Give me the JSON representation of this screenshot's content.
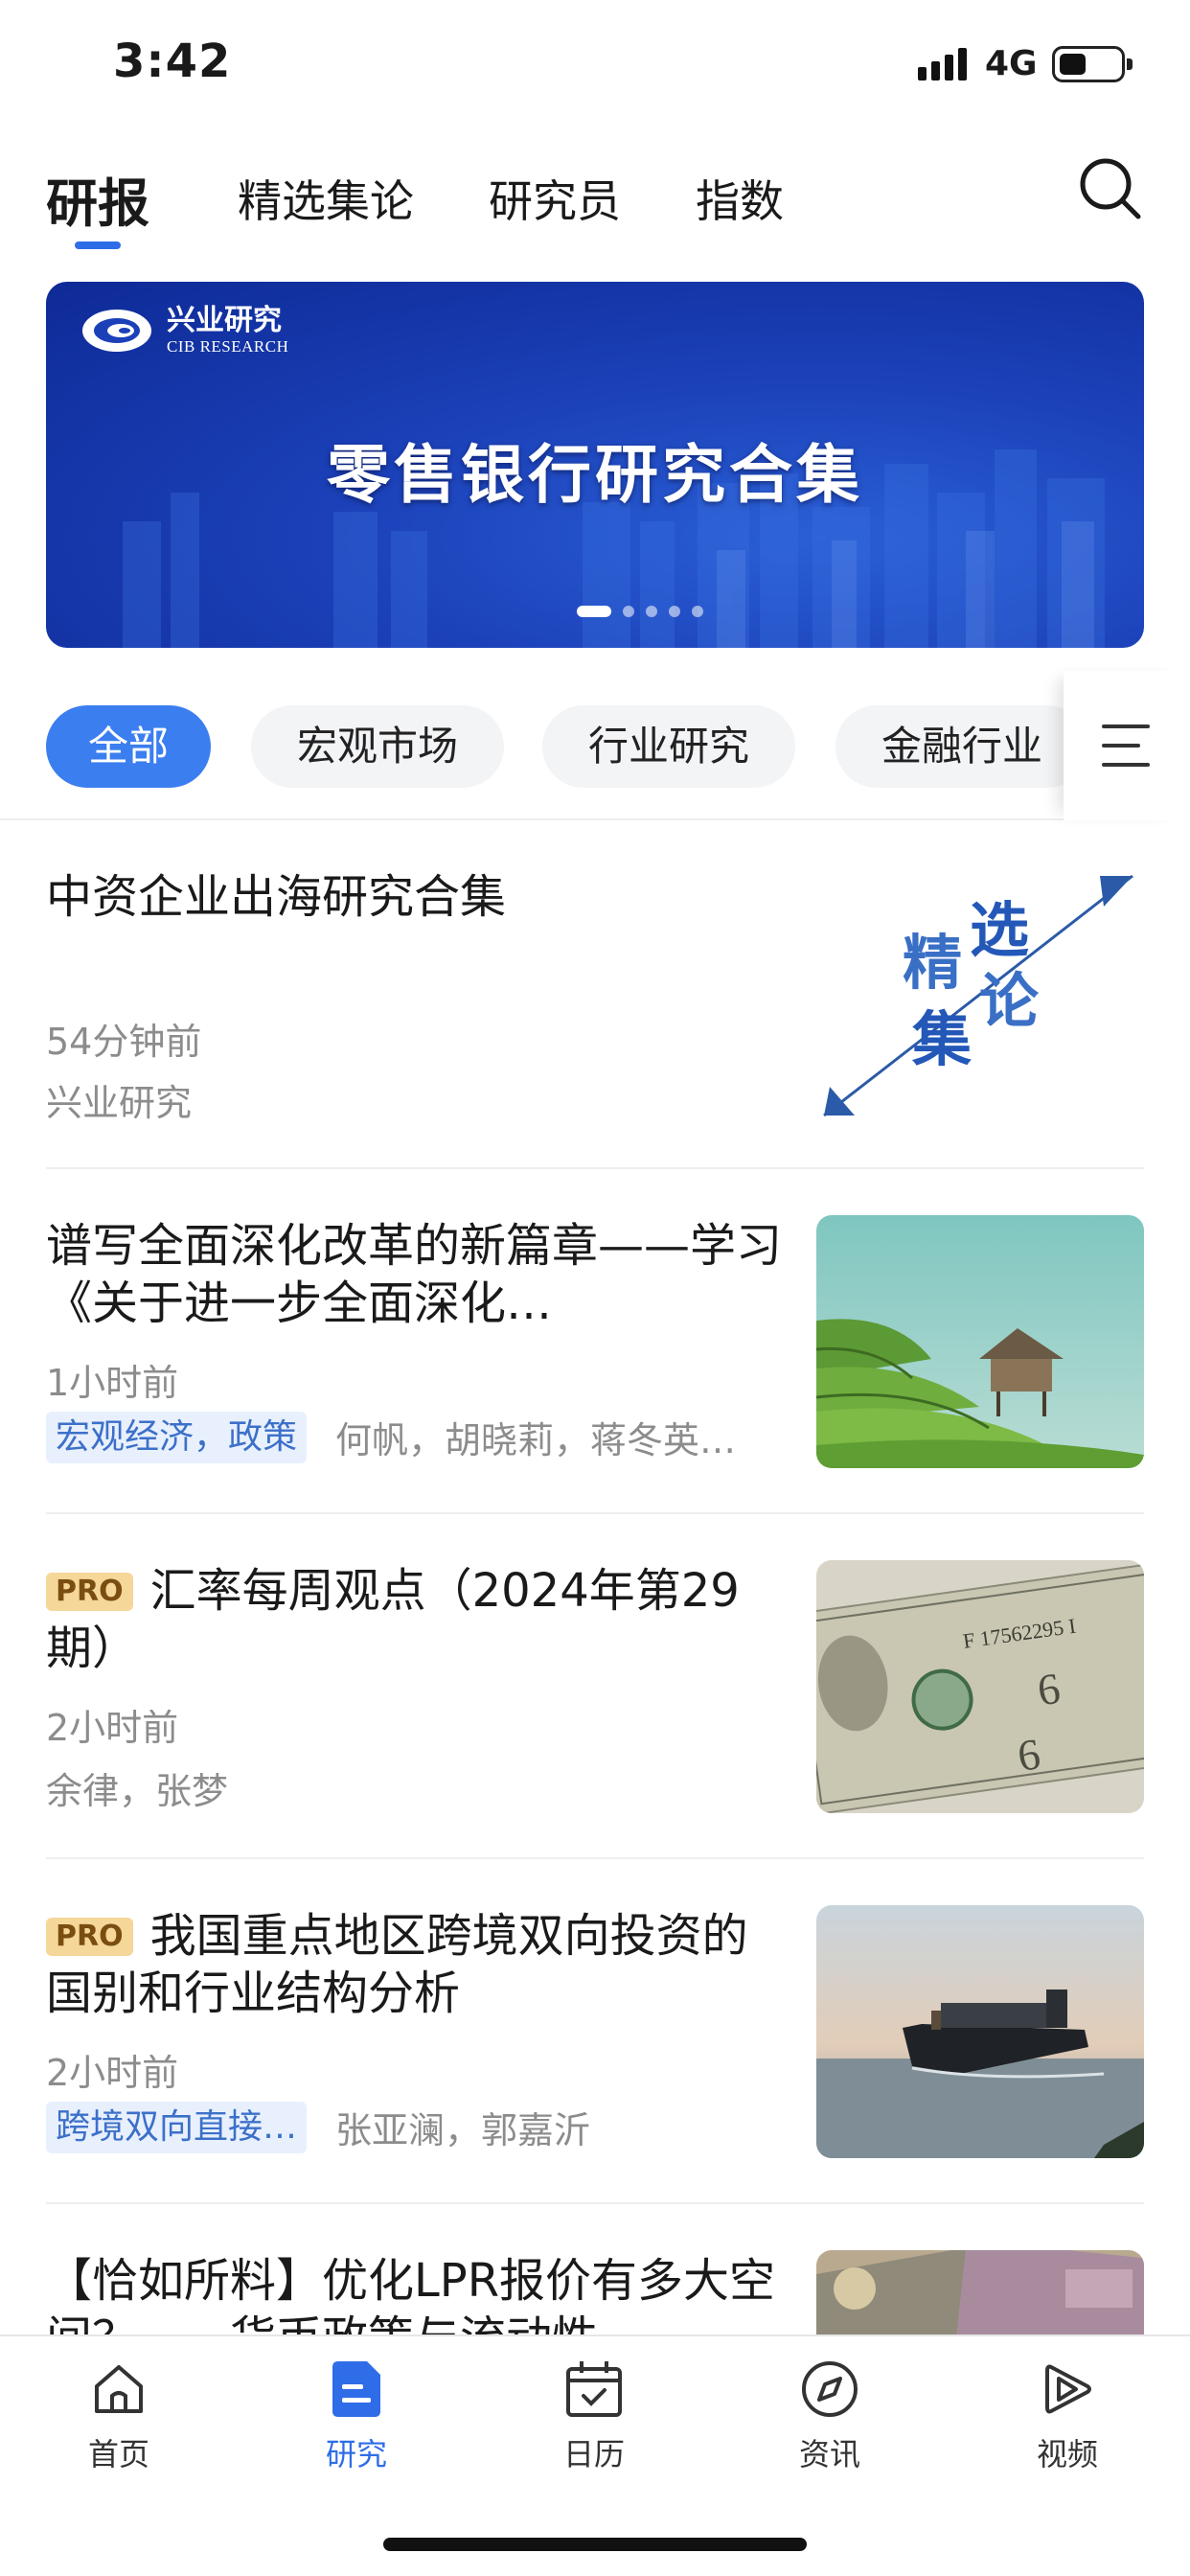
{
  "status_bar": {
    "time": "3:42",
    "network": "4G",
    "battery_level": 0.45
  },
  "top_tabs": [
    {
      "label": "研报",
      "active": true
    },
    {
      "label": "精选集论",
      "active": false
    },
    {
      "label": "研究员",
      "active": false
    },
    {
      "label": "指数",
      "active": false
    }
  ],
  "banner": {
    "logo_cn": "兴业研究",
    "logo_en": "CIB RESEARCH",
    "title": "零售银行研究合集",
    "page_count": 5,
    "active_page": 1
  },
  "categories": [
    {
      "label": "全部",
      "active": true
    },
    {
      "label": "宏观市场",
      "active": false
    },
    {
      "label": "行业研究",
      "active": false
    },
    {
      "label": "金融行业",
      "active": false
    }
  ],
  "articles": [
    {
      "title": "中资企业出海研究合集",
      "time": "54分钟前",
      "source": "兴业研究",
      "thumb_text": [
        "精",
        "选",
        "集",
        "论"
      ],
      "thumb_icon": "jingxuan-jilun-logo"
    },
    {
      "title": "谱写全面深化改革的新篇章——学习《关于进一步全面深化…",
      "time": "1小时前",
      "tag": "宏观经济，政策",
      "authors": "何帆，胡晓莉，蒋冬英…",
      "thumb_icon": "terraced-fields-hut-photo"
    },
    {
      "pro": "PRO",
      "title": "汇率每周观点（2024年第29期）",
      "time": "2小时前",
      "authors": "余律，张梦",
      "thumb_icon": "dollar-bills-photo"
    },
    {
      "pro": "PRO",
      "title": "我国重点地区跨境双向投资的国别和行业结构分析",
      "time": "2小时前",
      "tag": "跨境双向直接…",
      "authors": "张亚澜，郭嘉沂",
      "thumb_icon": "cargo-ship-photo"
    },
    {
      "title": "【恰如所料】优化LPR报价有多大空间？——货币政策与流动性…",
      "thumb_icon": "banknotes-photo"
    }
  ],
  "bottom_nav": [
    {
      "label": "首页",
      "icon": "home-icon",
      "active": false
    },
    {
      "label": "研究",
      "icon": "research-icon",
      "active": true
    },
    {
      "label": "日历",
      "icon": "calendar-icon",
      "active": false
    },
    {
      "label": "资讯",
      "icon": "compass-icon",
      "active": false
    },
    {
      "label": "视频",
      "icon": "play-icon",
      "active": false
    }
  ],
  "colors": {
    "accent": "#2f6de8",
    "chip_active": "#3b7ef0",
    "pro_badge": "#f6d79a",
    "tag_bg": "#e8f0fd",
    "tag_text": "#3c70c9",
    "muted": "#8c8c8c"
  }
}
